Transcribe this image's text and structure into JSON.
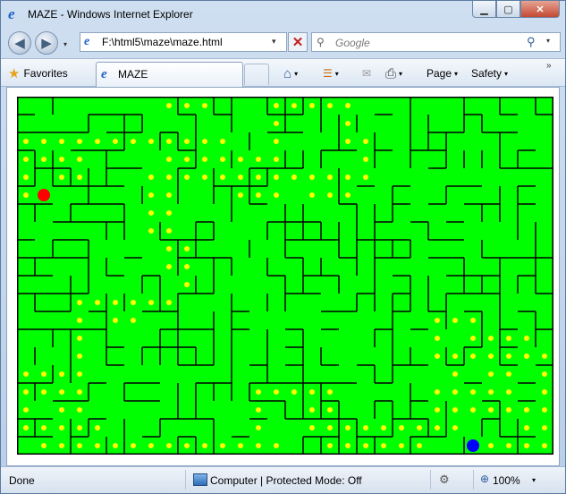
{
  "window": {
    "title": "MAZE - Windows Internet Explorer",
    "minimize": "▁",
    "maximize": "▢",
    "close": "✕"
  },
  "nav": {
    "back": "◀",
    "forward": "▶",
    "dropdown": "▾",
    "address": "F:\\html5\\maze\\maze.html",
    "refresh": "↻",
    "stop": "✕",
    "search_placeholder": "Google",
    "search_go": "⚲"
  },
  "command_bar": {
    "favorites_label": "Favorites",
    "tab_label": "MAZE",
    "home": "⌂",
    "feeds": "☰",
    "mail": "✉",
    "print": "⎙",
    "page_label": "Page",
    "safety_label": "Safety",
    "overflow": "»"
  },
  "status": {
    "left_text": "Done",
    "zone_text": "Computer | Protected Mode: Off",
    "zoom_text": "100%"
  },
  "maze": {
    "background_color": "#00ff00",
    "wall_color": "#000000",
    "dot_color": "#ffff00",
    "player_color": "#ff0000",
    "goal_color": "#0000ff",
    "cols": 30,
    "rows": 20,
    "player": {
      "col": 1,
      "row": 5
    },
    "goal": {
      "col": 25,
      "row": 19
    },
    "dots": [
      [
        8,
        0
      ],
      [
        9,
        0
      ],
      [
        10,
        0
      ],
      [
        14,
        0
      ],
      [
        15,
        0
      ],
      [
        16,
        0
      ],
      [
        17,
        0
      ],
      [
        18,
        0
      ],
      [
        14,
        1
      ],
      [
        18,
        1
      ],
      [
        0,
        2
      ],
      [
        1,
        2
      ],
      [
        2,
        2
      ],
      [
        3,
        2
      ],
      [
        4,
        2
      ],
      [
        5,
        2
      ],
      [
        6,
        2
      ],
      [
        7,
        2
      ],
      [
        8,
        2
      ],
      [
        9,
        2
      ],
      [
        10,
        2
      ],
      [
        11,
        2
      ],
      [
        14,
        2
      ],
      [
        18,
        2
      ],
      [
        19,
        2
      ],
      [
        0,
        3
      ],
      [
        1,
        3
      ],
      [
        2,
        3
      ],
      [
        3,
        3
      ],
      [
        8,
        3
      ],
      [
        9,
        3
      ],
      [
        10,
        3
      ],
      [
        11,
        3
      ],
      [
        12,
        3
      ],
      [
        13,
        3
      ],
      [
        14,
        3
      ],
      [
        19,
        3
      ],
      [
        0,
        4
      ],
      [
        2,
        4
      ],
      [
        3,
        4
      ],
      [
        7,
        4
      ],
      [
        8,
        4
      ],
      [
        9,
        4
      ],
      [
        10,
        4
      ],
      [
        11,
        4
      ],
      [
        12,
        4
      ],
      [
        13,
        4
      ],
      [
        14,
        4
      ],
      [
        15,
        4
      ],
      [
        16,
        4
      ],
      [
        17,
        4
      ],
      [
        18,
        4
      ],
      [
        19,
        4
      ],
      [
        0,
        5
      ],
      [
        7,
        5
      ],
      [
        8,
        5
      ],
      [
        12,
        5
      ],
      [
        13,
        5
      ],
      [
        14,
        5
      ],
      [
        16,
        5
      ],
      [
        17,
        5
      ],
      [
        18,
        5
      ],
      [
        7,
        6
      ],
      [
        8,
        6
      ],
      [
        7,
        7
      ],
      [
        8,
        7
      ],
      [
        8,
        8
      ],
      [
        9,
        8
      ],
      [
        8,
        9
      ],
      [
        9,
        9
      ],
      [
        9,
        10
      ],
      [
        3,
        11
      ],
      [
        4,
        11
      ],
      [
        5,
        11
      ],
      [
        6,
        11
      ],
      [
        7,
        11
      ],
      [
        8,
        11
      ],
      [
        3,
        12
      ],
      [
        5,
        12
      ],
      [
        6,
        12
      ],
      [
        23,
        12
      ],
      [
        24,
        12
      ],
      [
        25,
        12
      ],
      [
        3,
        13
      ],
      [
        23,
        13
      ],
      [
        25,
        13
      ],
      [
        26,
        13
      ],
      [
        27,
        13
      ],
      [
        28,
        13
      ],
      [
        3,
        14
      ],
      [
        23,
        14
      ],
      [
        24,
        14
      ],
      [
        25,
        14
      ],
      [
        26,
        14
      ],
      [
        27,
        14
      ],
      [
        28,
        14
      ],
      [
        29,
        14
      ],
      [
        0,
        15
      ],
      [
        1,
        15
      ],
      [
        2,
        15
      ],
      [
        3,
        15
      ],
      [
        24,
        15
      ],
      [
        26,
        15
      ],
      [
        27,
        15
      ],
      [
        29,
        15
      ],
      [
        0,
        16
      ],
      [
        1,
        16
      ],
      [
        2,
        16
      ],
      [
        3,
        16
      ],
      [
        13,
        16
      ],
      [
        14,
        16
      ],
      [
        15,
        16
      ],
      [
        16,
        16
      ],
      [
        17,
        16
      ],
      [
        23,
        16
      ],
      [
        24,
        16
      ],
      [
        25,
        16
      ],
      [
        26,
        16
      ],
      [
        27,
        16
      ],
      [
        29,
        16
      ],
      [
        0,
        17
      ],
      [
        2,
        17
      ],
      [
        3,
        17
      ],
      [
        13,
        17
      ],
      [
        16,
        17
      ],
      [
        17,
        17
      ],
      [
        23,
        17
      ],
      [
        24,
        17
      ],
      [
        25,
        17
      ],
      [
        26,
        17
      ],
      [
        27,
        17
      ],
      [
        28,
        17
      ],
      [
        29,
        17
      ],
      [
        0,
        18
      ],
      [
        1,
        18
      ],
      [
        2,
        18
      ],
      [
        3,
        18
      ],
      [
        4,
        18
      ],
      [
        13,
        18
      ],
      [
        16,
        18
      ],
      [
        17,
        18
      ],
      [
        18,
        18
      ],
      [
        19,
        18
      ],
      [
        20,
        18
      ],
      [
        21,
        18
      ],
      [
        22,
        18
      ],
      [
        23,
        18
      ],
      [
        24,
        18
      ],
      [
        28,
        18
      ],
      [
        29,
        18
      ],
      [
        1,
        19
      ],
      [
        2,
        19
      ],
      [
        3,
        19
      ],
      [
        4,
        19
      ],
      [
        5,
        19
      ],
      [
        6,
        19
      ],
      [
        7,
        19
      ],
      [
        8,
        19
      ],
      [
        9,
        19
      ],
      [
        10,
        19
      ],
      [
        11,
        19
      ],
      [
        12,
        19
      ],
      [
        13,
        19
      ],
      [
        14,
        19
      ],
      [
        17,
        19
      ],
      [
        18,
        19
      ],
      [
        19,
        19
      ],
      [
        20,
        19
      ],
      [
        21,
        19
      ],
      [
        22,
        19
      ],
      [
        26,
        19
      ],
      [
        27,
        19
      ],
      [
        28,
        19
      ],
      [
        29,
        19
      ]
    ]
  }
}
